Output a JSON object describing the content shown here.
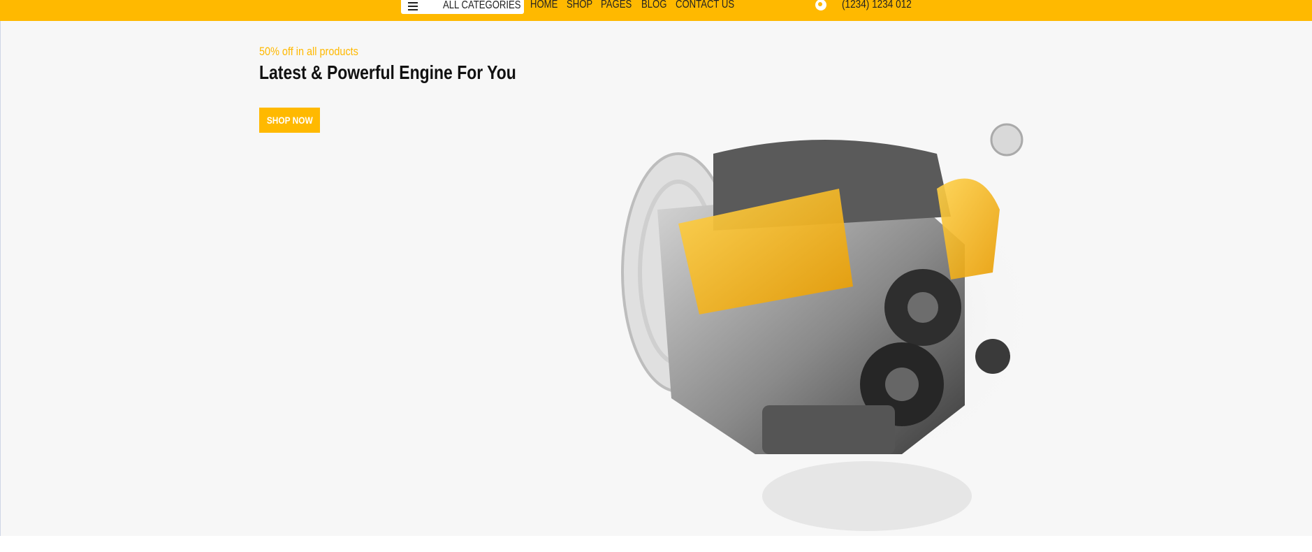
{
  "header": {
    "categories_label": "ALL CATEGORIES",
    "menu_icon": "hamburger-icon",
    "nav": [
      "HOME",
      "SHOP",
      "PAGES",
      "BLOG",
      "CONTACT US"
    ],
    "phone_icon": "phone-icon",
    "phone": "(1234) 1234 012"
  },
  "hero": {
    "offer": "50% off in all products",
    "headline": "Latest & Powerful Engine For You",
    "cta": "SHOP NOW",
    "image": "engine-image"
  },
  "colors": {
    "accent": "#ffb900",
    "hero_bg": "#f7f7f7",
    "text": "#111111"
  }
}
